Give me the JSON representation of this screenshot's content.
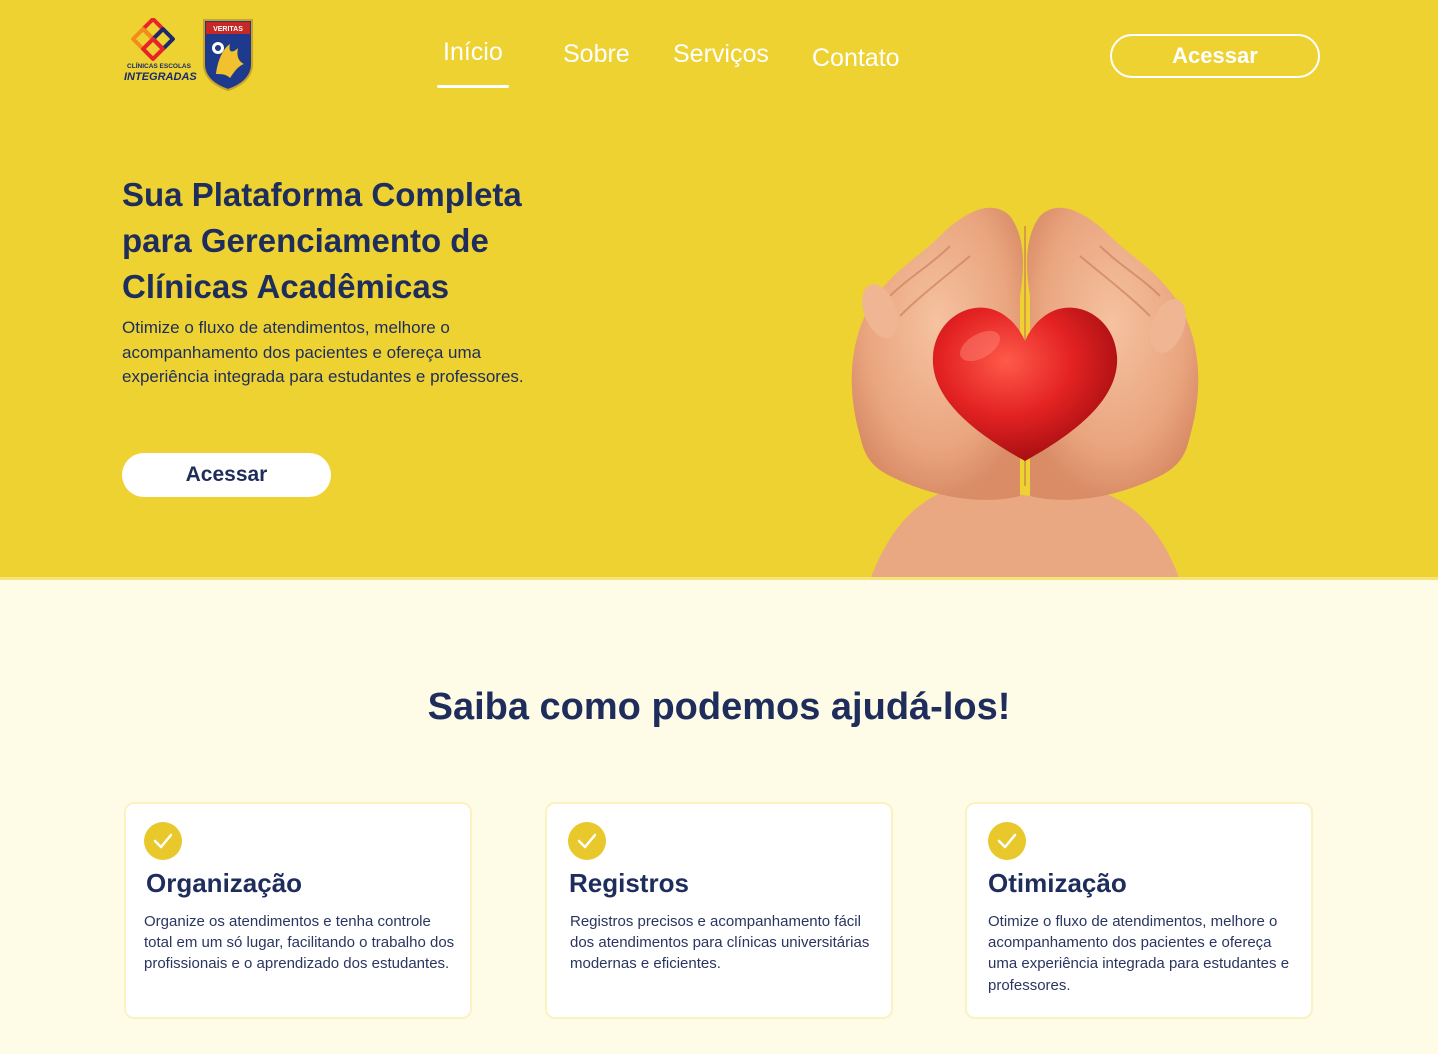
{
  "brand": {
    "logo_line1": "CLÍNICAS ESCOLAS",
    "logo_line2": "INTEGRADAS",
    "shield_text": "VERITAS"
  },
  "nav": {
    "items": [
      "Início",
      "Sobre",
      "Serviços",
      "Contato"
    ],
    "active": "Início",
    "cta": "Acessar"
  },
  "hero": {
    "title": "Sua Plataforma Completa para Gerenciamento de Clínicas Acadêmicas",
    "subtitle": "Otimize o fluxo de atendimentos, melhore o acompanhamento dos pacientes e ofereça uma experiência integrada para estudantes e professores.",
    "cta": "Acessar",
    "image": "hands-holding-red-heart"
  },
  "features": {
    "title": "Saiba como podemos ajudá-los!",
    "cards": [
      {
        "icon": "check-icon",
        "title": "Organização",
        "text": "Organize os atendimentos e tenha controle total em um só lugar, facilitando o trabalho dos profissionais e o aprendizado dos estudantes."
      },
      {
        "icon": "check-icon",
        "title": "Registros",
        "text": "Registros precisos e acompanhamento fácil dos atendimentos para clínicas universitárias modernas e eficientes."
      },
      {
        "icon": "check-icon",
        "title": "Otimização",
        "text": "Otimize o fluxo de atendimentos, melhore o acompanhamento dos pacientes e ofereça uma experiência integrada para estudantes e professores."
      }
    ]
  },
  "colors": {
    "hero_bg": "#edd232",
    "page_bg": "#fefbe6",
    "navy": "#1e2d5c",
    "accent_yellow": "#e8c82a",
    "heart_red": "#d91e1e"
  }
}
